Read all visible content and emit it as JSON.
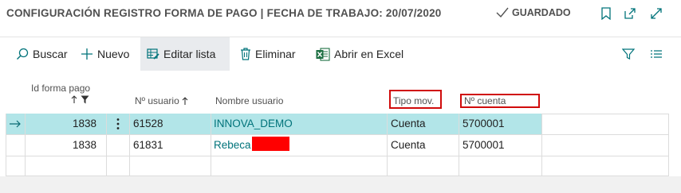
{
  "header": {
    "title": "CONFIGURACIÓN REGISTRO FORMA DE PAGO | FECHA DE TRABAJO: 20/07/2020",
    "saved_label": "GUARDADO"
  },
  "actions": {
    "search": "Buscar",
    "new": "Nuevo",
    "edit_list": "Editar lista",
    "delete": "Eliminar",
    "open_excel": "Abrir en Excel"
  },
  "table": {
    "columns": {
      "payment_id": "Id forma pago",
      "user_no": "Nº usuario",
      "user_name": "Nombre usuario",
      "mov_type": "Tipo mov.",
      "account_no": "Nº cuenta"
    },
    "rows": [
      {
        "payment_id": "1838",
        "user_no": "61528",
        "user_name": "INNOVA_DEMO",
        "mov_type": "Cuenta",
        "account_no": "5700001"
      },
      {
        "payment_id": "1838",
        "user_no": "61831",
        "user_name": "Rebeca",
        "mov_type": "Cuenta",
        "account_no": "5700001"
      }
    ]
  },
  "colors": {
    "selected_row": "#b2e5e8",
    "link": "#00737a",
    "highlight_box": "#d00b0b",
    "accent": "#00737a"
  }
}
